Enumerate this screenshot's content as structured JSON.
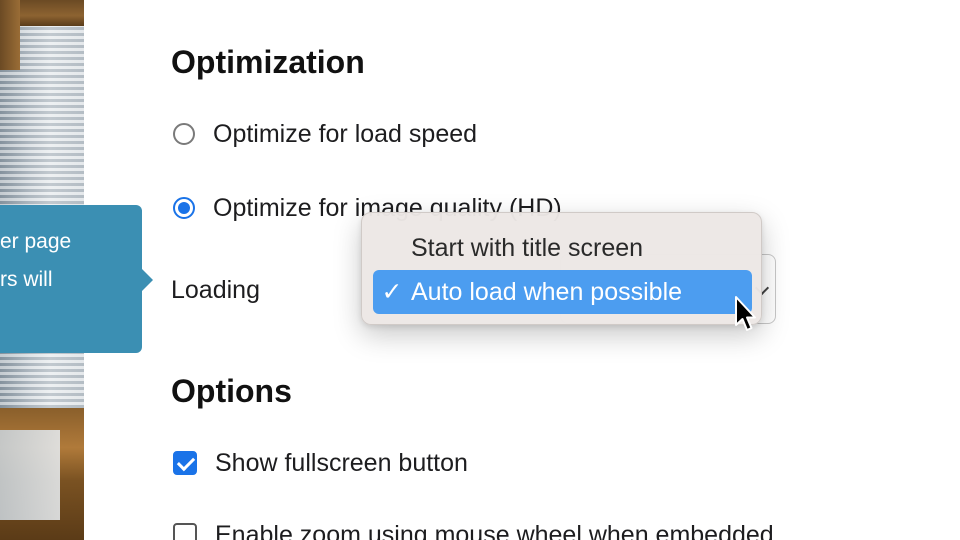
{
  "tooltip": {
    "line1": "er page",
    "line2": "rs will"
  },
  "optimization": {
    "title": "Optimization",
    "options": [
      {
        "label": "Optimize for load speed",
        "selected": false
      },
      {
        "label": "Optimize for image quality (HD)",
        "selected": true
      }
    ]
  },
  "loading": {
    "label": "Loading",
    "menu": [
      {
        "label": "Start with title screen",
        "checked": false
      },
      {
        "label": "Auto load when possible",
        "checked": true
      }
    ],
    "check_glyph": "✓"
  },
  "options": {
    "title": "Options",
    "items": [
      {
        "label": "Show fullscreen button",
        "checked": true
      },
      {
        "label": "Enable zoom using mouse wheel when embedded",
        "checked": false
      }
    ]
  },
  "colors": {
    "accent": "#1a73e8",
    "tooltip_bg": "#3b8fb3",
    "menu_highlight": "#4c9df0",
    "menu_bg": "#ece7e5"
  },
  "icons": {
    "cursor": "arrow-cursor-icon",
    "chevron": "chevron-down-icon"
  }
}
